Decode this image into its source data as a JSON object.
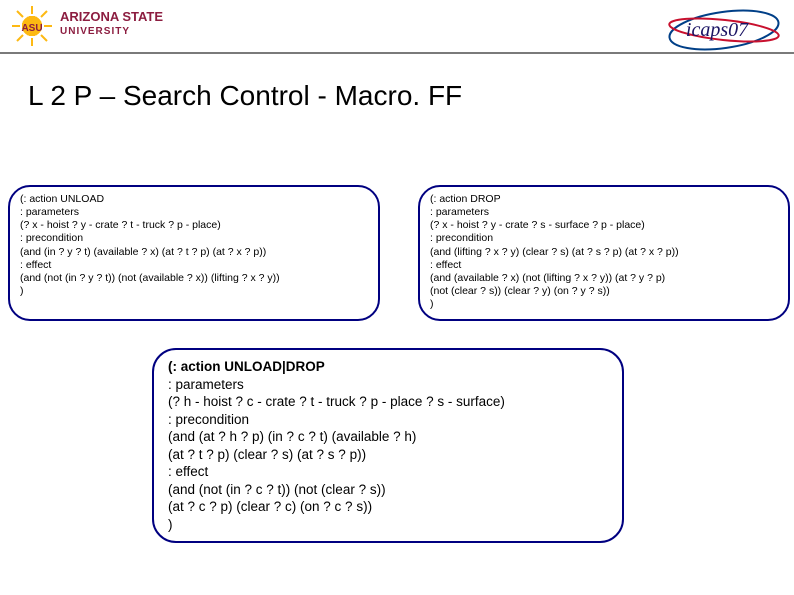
{
  "header": {
    "asu_name_line1": "ARIZONA STATE",
    "asu_name_line2": "UNIVERSITY",
    "asu_mark": "ASU",
    "icaps_text": "icaps07"
  },
  "title": "L 2 P – Search Control - Macro. FF",
  "unload": {
    "l1": "(: action UNLOAD",
    "l2": ": parameters",
    "l3": "(? x - hoist ? y - crate ? t - truck ? p - place)",
    "l4": ": precondition",
    "l5": "(and (in ? y ? t) (available ? x) (at ? t ? p) (at ? x ? p))",
    "l6": ": effect",
    "l7": "(and (not (in ? y ? t)) (not (available ? x)) (lifting ? x ? y))",
    "l8": ")"
  },
  "drop": {
    "l1": "(: action DROP",
    "l2": ": parameters",
    "l3": "(? x - hoist ? y - crate ? s - surface ? p - place)",
    "l4": ": precondition",
    "l5": "(and (lifting ? x ? y) (clear ? s) (at ? s ? p) (at ? x ? p))",
    "l6": ": effect",
    "l7": "(and (available ? x) (not (lifting ? x ? y)) (at ? y ? p)",
    "l8": "(not (clear ? s)) (clear ? y) (on ? y ? s))",
    "l9": ")"
  },
  "combo": {
    "l1": "(: action UNLOAD|DROP",
    "l2": ": parameters",
    "l3": "(? h - hoist ? c - crate ? t - truck ? p - place ? s - surface)",
    "l4": ": precondition",
    "l5": "(and (at ? h ? p) (in ? c ? t) (available ? h)",
    "l6": "(at ? t ? p) (clear ? s) (at ? s ? p))",
    "l7": ": effect",
    "l8": "(and (not (in ? c ? t)) (not (clear ? s))",
    "l9": "(at ? c ? p) (clear ? c) (on ? c ? s))",
    "l10": ")"
  }
}
